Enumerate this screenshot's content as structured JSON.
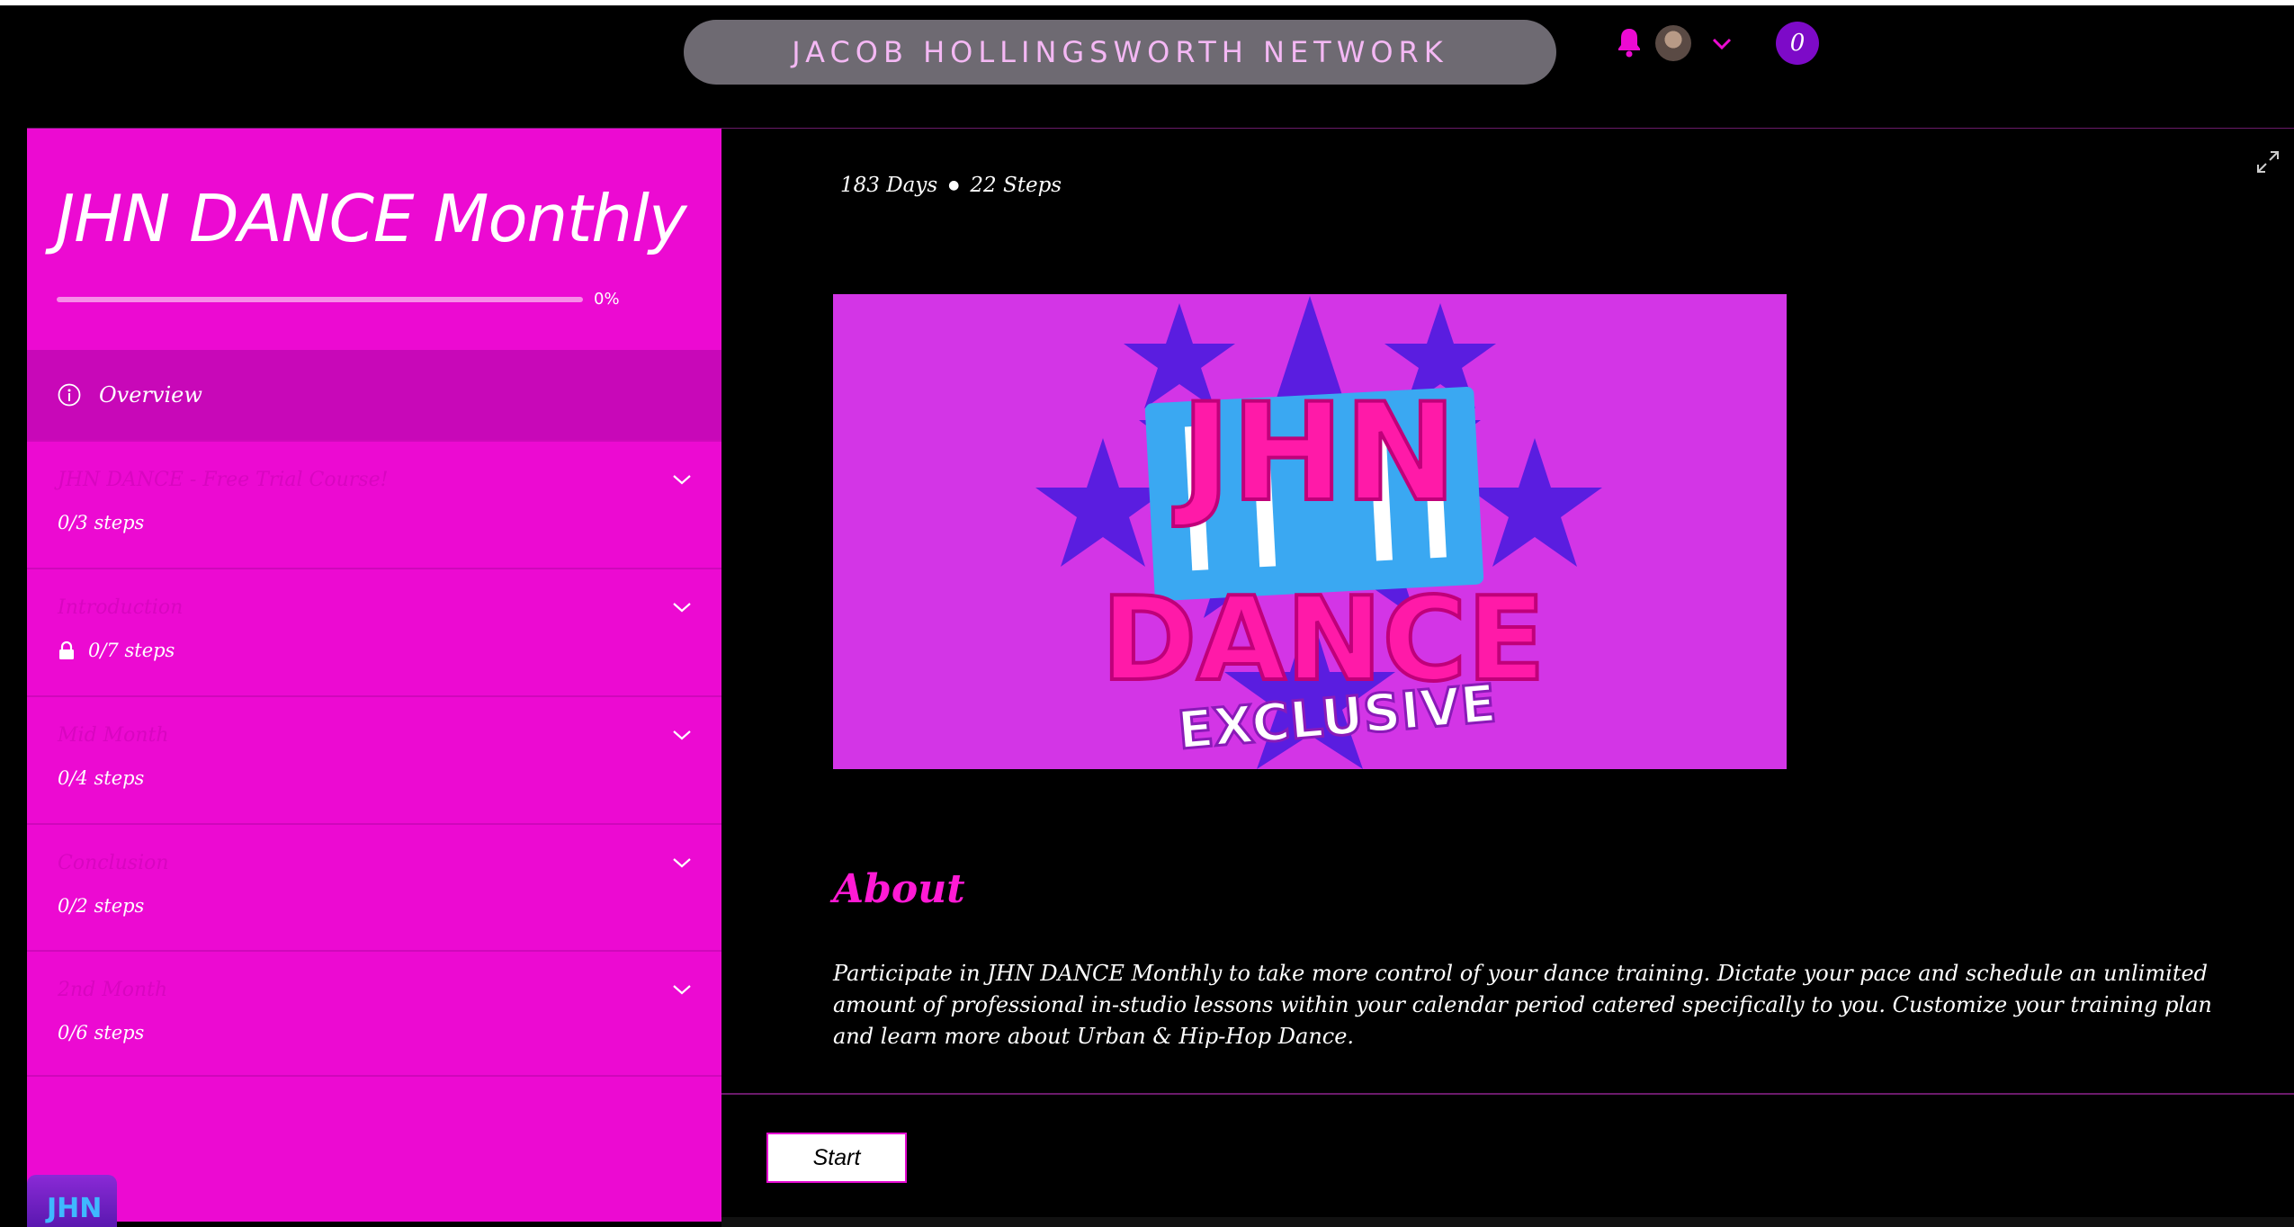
{
  "header": {
    "site_title": "JACOB HOLLINGSWORTH NETWORK",
    "cart_count": "0",
    "notification_icon": "bell-icon",
    "accent_color": "#ec0ad2",
    "cart_color": "#7d0ac8"
  },
  "sidebar": {
    "program_title": "JHN DANCE Monthly",
    "progress_percent": 0,
    "progress_label": "0%",
    "overview_label": "Overview",
    "sections": [
      {
        "title": "JHN DANCE - Free Trial Course!",
        "steps": "0/3 steps",
        "locked": false
      },
      {
        "title": "Introduction",
        "steps": "0/7 steps",
        "locked": true
      },
      {
        "title": "Mid Month",
        "steps": "0/4 steps",
        "locked": false
      },
      {
        "title": "Conclusion",
        "steps": "0/2 steps",
        "locked": false
      },
      {
        "title": "2nd Month",
        "steps": "0/6 steps",
        "locked": false
      }
    ],
    "mini_logo_text": "JHN"
  },
  "main": {
    "duration": "183 Days",
    "step_count": "22 Steps",
    "hero": {
      "line1": "JHN",
      "line2": "DANCE",
      "line3": "EXCLUSIVE"
    },
    "about_heading": "About",
    "description": "Participate in JHN DANCE Monthly to take more control of your dance training. Dictate your pace and schedule an unlimited amount of professional in-studio lessons within your calendar period catered specifically to you. Customize your training plan and learn more about Urban & Hip-Hop Dance.",
    "start_label": "Start"
  }
}
